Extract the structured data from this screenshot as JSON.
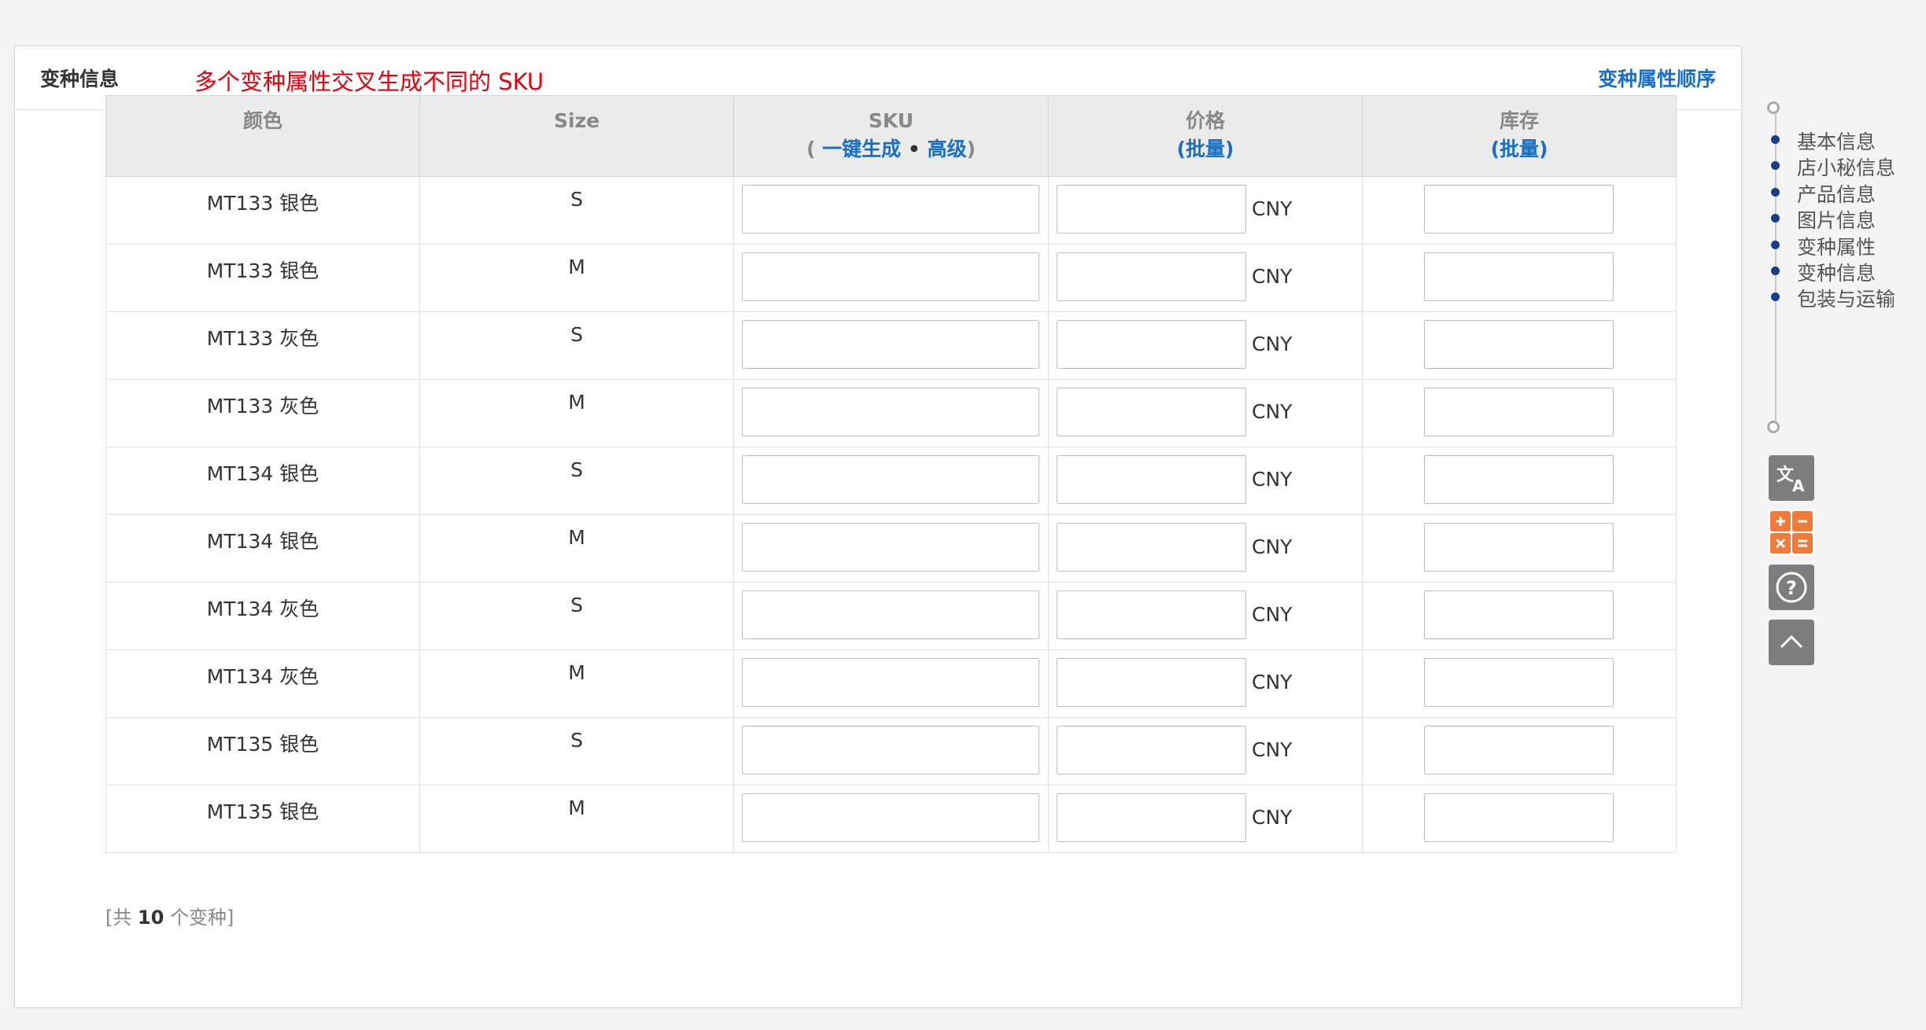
{
  "panel": {
    "title": "变种信息",
    "annotation": "多个变种属性交叉生成不同的 SKU",
    "order_link": "变种属性顺序"
  },
  "table": {
    "headers": {
      "color": "颜色",
      "size": "Size",
      "sku": "SKU",
      "sku_open": "(",
      "sku_generate": "一键生成",
      "sku_sep": "•",
      "sku_advanced": "高级",
      "sku_close": ")",
      "price": "价格",
      "price_batch": "(批量)",
      "stock": "库存",
      "stock_batch": "(批量)"
    },
    "currency": "CNY",
    "rows": [
      {
        "color": "MT133 银色",
        "size": "S"
      },
      {
        "color": "MT133 银色",
        "size": "M"
      },
      {
        "color": "MT133 灰色",
        "size": "S"
      },
      {
        "color": "MT133 灰色",
        "size": "M"
      },
      {
        "color": "MT134 银色",
        "size": "S"
      },
      {
        "color": "MT134 银色",
        "size": "M"
      },
      {
        "color": "MT134 灰色",
        "size": "S"
      },
      {
        "color": "MT134 灰色",
        "size": "M"
      },
      {
        "color": "MT135 银色",
        "size": "S"
      },
      {
        "color": "MT135 银色",
        "size": "M"
      }
    ]
  },
  "total": {
    "prefix": "[共",
    "count": "10",
    "suffix": "个变种]"
  },
  "nav": {
    "items": [
      "基本信息",
      "店小秘信息",
      "产品信息",
      "图片信息",
      "变种属性",
      "变种信息",
      "包装与运输"
    ]
  },
  "tools": {
    "translate_icon": "translate-icon",
    "calculator_icon": "calculator-icon",
    "help_icon": "help-icon",
    "back_to_top_icon": "chevron-up-icon"
  },
  "colors": {
    "accent": "#1a6fc4",
    "annotation": "#e8000d",
    "nav_dot": "#1a3c8c",
    "calculator": "#f07a3a"
  }
}
